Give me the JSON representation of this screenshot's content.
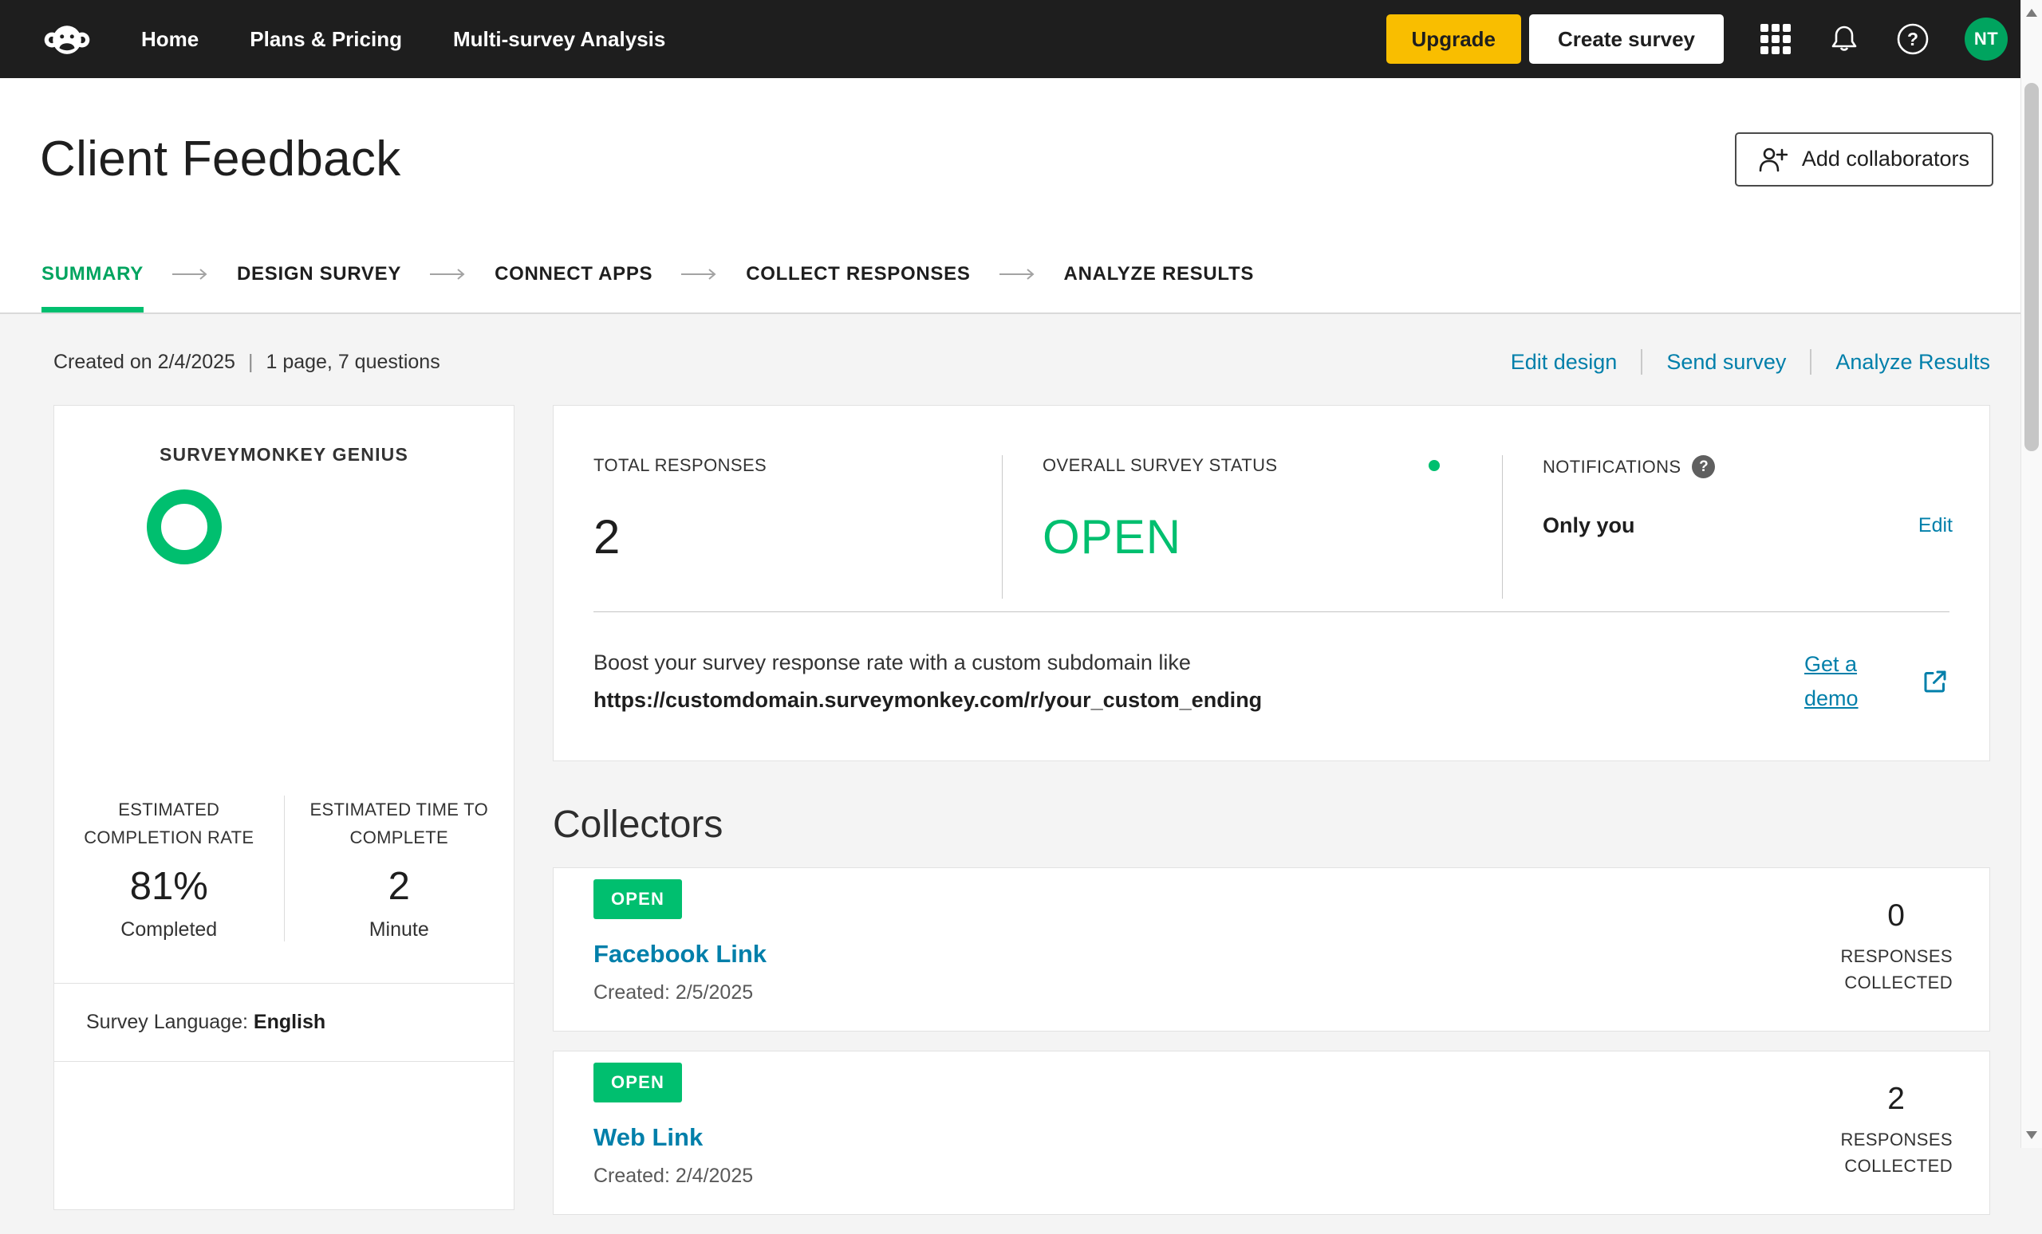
{
  "colors": {
    "accent_green": "#00bf6f",
    "upgrade_gold": "#f9be00",
    "link_blue": "#007faa",
    "nav_bg": "#1e1e1e"
  },
  "nav": {
    "items": [
      {
        "label": "Home"
      },
      {
        "label": "Plans & Pricing"
      },
      {
        "label": "Multi-survey Analysis"
      }
    ],
    "upgrade": "Upgrade",
    "create_survey": "Create survey",
    "avatar_initials": "NT"
  },
  "header": {
    "title": "Client Feedback",
    "add_collaborators": "Add collaborators"
  },
  "tabs": [
    {
      "label": "SUMMARY",
      "active": true
    },
    {
      "label": "DESIGN SURVEY",
      "active": false
    },
    {
      "label": "CONNECT APPS",
      "active": false
    },
    {
      "label": "COLLECT RESPONSES",
      "active": false
    },
    {
      "label": "ANALYZE RESULTS",
      "active": false
    }
  ],
  "meta": {
    "created": "Created on 2/4/2025",
    "separator": "|",
    "details": "1 page, 7 questions",
    "actions": [
      {
        "label": "Edit design"
      },
      {
        "label": "Send survey"
      },
      {
        "label": "Analyze Results"
      }
    ]
  },
  "genius": {
    "title": "SURVEYMONKEY GENIUS",
    "completion_label": "ESTIMATED COMPLETION RATE",
    "completion_value": "81%",
    "completion_caption": "Completed",
    "time_label": "ESTIMATED TIME TO COMPLETE",
    "time_value": "2",
    "time_caption": "Minute",
    "language_label": "Survey Language:",
    "language_value": "English"
  },
  "status": {
    "total_label": "TOTAL RESPONSES",
    "total_value": "2",
    "status_label": "OVERALL SURVEY STATUS",
    "status_value": "OPEN",
    "notifications_label": "NOTIFICATIONS",
    "notifications_value": "Only you",
    "edit": "Edit",
    "help_glyph": "?",
    "boost_line1": "Boost your survey response rate with a custom subdomain like",
    "boost_line2": "https://customdomain.surveymonkey.com/r/your_custom_ending",
    "demo_link": "Get a demo"
  },
  "collectors": {
    "title": "Collectors",
    "items": [
      {
        "status": "OPEN",
        "name": "Facebook Link",
        "created": "Created: 2/5/2025",
        "responses": "0",
        "responses_label": "RESPONSES COLLECTED"
      },
      {
        "status": "OPEN",
        "name": "Web Link",
        "created": "Created: 2/4/2025",
        "responses": "2",
        "responses_label": "RESPONSES COLLECTED"
      }
    ]
  }
}
